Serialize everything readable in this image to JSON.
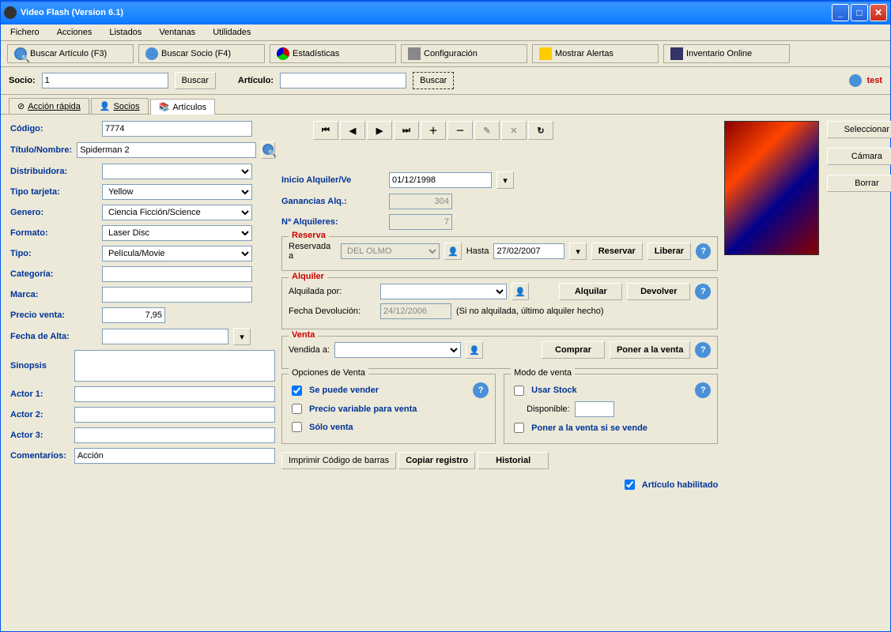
{
  "window": {
    "title": "Video Flash (Version 6.1)"
  },
  "menu": {
    "fichero": "Fichero",
    "acciones": "Acciones",
    "listados": "Listados",
    "ventanas": "Ventanas",
    "utilidades": "Utilidades"
  },
  "toolbar": {
    "buscar_articulo": "Buscar Artículo (F3)",
    "buscar_socio": "Buscar Socio (F4)",
    "estadisticas": "Estadísticas",
    "configuracion": "Configuración",
    "mostrar_alertas": "Mostrar Alertas",
    "inventario_online": "Inventario Online"
  },
  "search": {
    "socio_label": "Socio:",
    "socio_value": "1",
    "buscar_btn": "Buscar",
    "articulo_label": "Artículo:",
    "articulo_value": "",
    "articulo_buscar": "Buscar",
    "user": "test"
  },
  "tabs": {
    "accion_rapida": "Acción rápida",
    "socios": "Socios",
    "articulos": "Artículos"
  },
  "nav": {
    "first": "⏮",
    "prev": "◀",
    "next": "▶",
    "last": "⏭",
    "add": "＋",
    "remove": "－",
    "edit": "✎",
    "cancel": "✕",
    "refresh": "↻"
  },
  "form": {
    "codigo_label": "Código:",
    "codigo": "7774",
    "titulo_label": "Título/Nombre:",
    "titulo": "Spiderman 2",
    "distribuidora_label": "Distribuidora:",
    "distribuidora": "",
    "tipo_tarjeta_label": "Tipo tarjeta:",
    "tipo_tarjeta": "Yellow",
    "genero_label": "Genero:",
    "genero": "Ciencia Ficción/Science",
    "formato_label": "Formato:",
    "formato": "Laser Disc",
    "tipo_label": "Tipo:",
    "tipo": "Película/Movie",
    "categoria_label": "Categoría:",
    "categoria": "",
    "marca_label": "Marca:",
    "marca": "",
    "precio_label": "Precio venta:",
    "precio": "7,95",
    "fecha_alta_label": "Fecha de Alta:",
    "fecha_alta": "",
    "sinopsis_label": "Sinopsis",
    "sinopsis": "",
    "actor1_label": "Actor 1:",
    "actor1": "",
    "actor2_label": "Actor 2:",
    "actor2": "",
    "actor3_label": "Actor 3:",
    "actor3": "",
    "comentarios_label": "Comentarios:",
    "comentarios": "Acción"
  },
  "mid": {
    "inicio_alquiler_label": "Inicio Alquiler/Ve",
    "inicio_alquiler": "01/12/1998",
    "ganancias_label": "Ganancias Alq.:",
    "ganancias": "304",
    "n_alquileres_label": "Nª Alquileres:",
    "n_alquileres": "7"
  },
  "reserva": {
    "legend": "Reserva",
    "reservada_label": "Reservada a",
    "reservada_a": "DEL OLMO",
    "hasta_label": "Hasta",
    "hasta": "27/02/2007",
    "reservar_btn": "Reservar",
    "liberar_btn": "Liberar"
  },
  "alquiler": {
    "legend": "Alquiler",
    "alquilada_label": "Alquilada por:",
    "alquilada_por": "",
    "alquilar_btn": "Alquilar",
    "devolver_btn": "Devolver",
    "fecha_dev_label": "Fecha Devolución:",
    "fecha_dev": "24/12/2006",
    "note": "(Si no alquilada, último alquiler hecho)"
  },
  "venta": {
    "legend": "Venta",
    "vendida_label": "Vendida a:",
    "vendida_a": "",
    "comprar_btn": "Comprar",
    "poner_btn": "Poner a la venta"
  },
  "opciones_venta": {
    "legend": "Opciones de Venta",
    "se_puede_vender": "Se puede vender",
    "precio_variable": "Precio variable para venta",
    "solo_venta": "Sólo venta"
  },
  "modo_venta": {
    "legend": "Modo de venta",
    "usar_stock": "Usar Stock",
    "disponible_label": "Disponible:",
    "disponible": "",
    "poner_si_vende": "Poner a la venta si se vende"
  },
  "bottom_btns": {
    "imprimir": "Imprimir Código de barras",
    "copiar": "Copiar registro",
    "historial": "Historial",
    "articulo_habilitado": "Artículo habilitado"
  },
  "poster_btns": {
    "seleccionar": "Seleccionar",
    "camara": "Cámara",
    "borrar": "Borrar"
  }
}
